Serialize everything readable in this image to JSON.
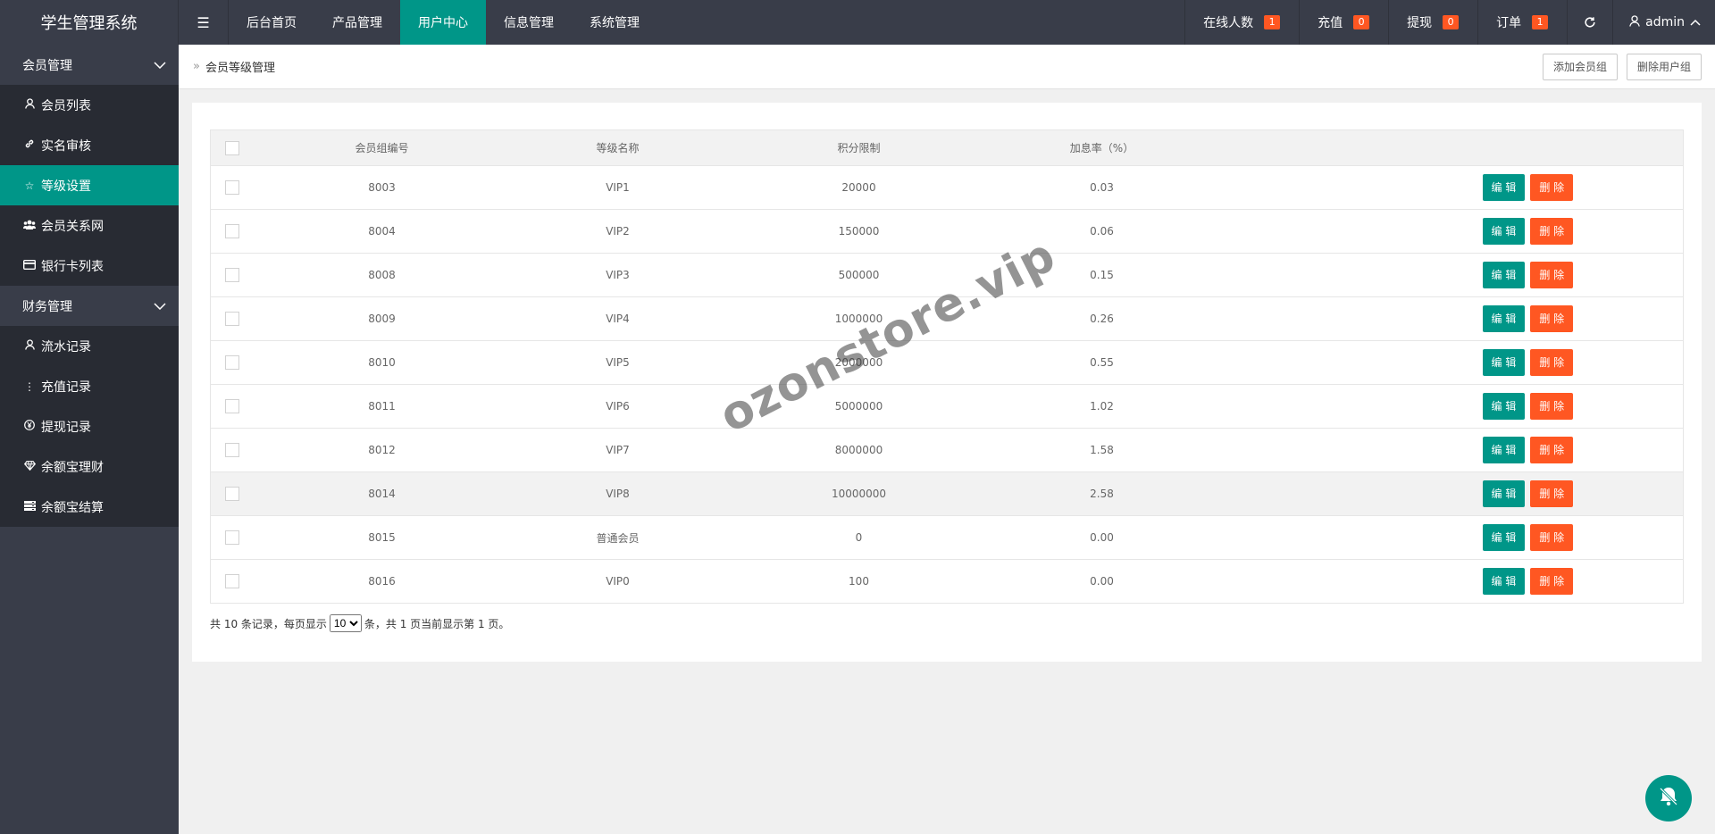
{
  "app": {
    "title": "学生管理系统"
  },
  "header": {
    "toggle_icon": "menu-fold-icon",
    "nav": [
      "后台首页",
      "产品管理",
      "用户中心",
      "信息管理",
      "系统管理"
    ],
    "active_nav": 2,
    "right": [
      {
        "label": "在线人数",
        "badge": "1"
      },
      {
        "label": "充值",
        "badge": "0"
      },
      {
        "label": "提现",
        "badge": "0"
      },
      {
        "label": "订单",
        "badge": "1"
      }
    ],
    "user": "admin"
  },
  "sidebar": {
    "groups": [
      {
        "label": "会员管理",
        "items": [
          {
            "label": "会员列表",
            "icon": "user-icon"
          },
          {
            "label": "实名审核",
            "icon": "link-icon"
          },
          {
            "label": "等级设置",
            "icon": "star-icon"
          },
          {
            "label": "会员关系网",
            "icon": "group-icon"
          },
          {
            "label": "银行卡列表",
            "icon": "card-icon"
          }
        ]
      },
      {
        "label": "财务管理",
        "items": [
          {
            "label": "流水记录",
            "icon": "user-icon"
          },
          {
            "label": "充值记录",
            "icon": "more-vertical-icon"
          },
          {
            "label": "提现记录",
            "icon": "yen-icon"
          },
          {
            "label": "余额宝理财",
            "icon": "diamond-icon"
          },
          {
            "label": "余额宝结算",
            "icon": "server-icon"
          }
        ]
      }
    ]
  },
  "breadcrumb": {
    "text": "会员等级管理"
  },
  "actions": {
    "add": "添加会员组",
    "delete": "删除用户组"
  },
  "table": {
    "headers": [
      "会员组编号",
      "等级名称",
      "积分限制",
      "加息率（%）"
    ],
    "edit_label": "编 辑",
    "delete_label": "删 除",
    "rows": [
      {
        "id": "8003",
        "name": "VIP1",
        "limit": "20000",
        "rate": "0.03"
      },
      {
        "id": "8004",
        "name": "VIP2",
        "limit": "150000",
        "rate": "0.06"
      },
      {
        "id": "8008",
        "name": "VIP3",
        "limit": "500000",
        "rate": "0.15"
      },
      {
        "id": "8009",
        "name": "VIP4",
        "limit": "1000000",
        "rate": "0.26"
      },
      {
        "id": "8010",
        "name": "VIP5",
        "limit": "2000000",
        "rate": "0.55"
      },
      {
        "id": "8011",
        "name": "VIP6",
        "limit": "5000000",
        "rate": "1.02"
      },
      {
        "id": "8012",
        "name": "VIP7",
        "limit": "8000000",
        "rate": "1.58"
      },
      {
        "id": "8014",
        "name": "VIP8",
        "limit": "10000000",
        "rate": "2.58"
      },
      {
        "id": "8015",
        "name": "普通会员",
        "limit": "0",
        "rate": "0.00"
      },
      {
        "id": "8016",
        "name": "VIP0",
        "limit": "100",
        "rate": "0.00"
      }
    ]
  },
  "pager": {
    "prefix": "共 10 条记录，每页显示",
    "page_size": "10",
    "suffix": "条，共 1 页当前显示第 1 页。"
  },
  "watermark": "ozonstore.vip",
  "colors": {
    "header_bg": "#393D49",
    "accent": "#009688",
    "danger": "#FF5722"
  }
}
